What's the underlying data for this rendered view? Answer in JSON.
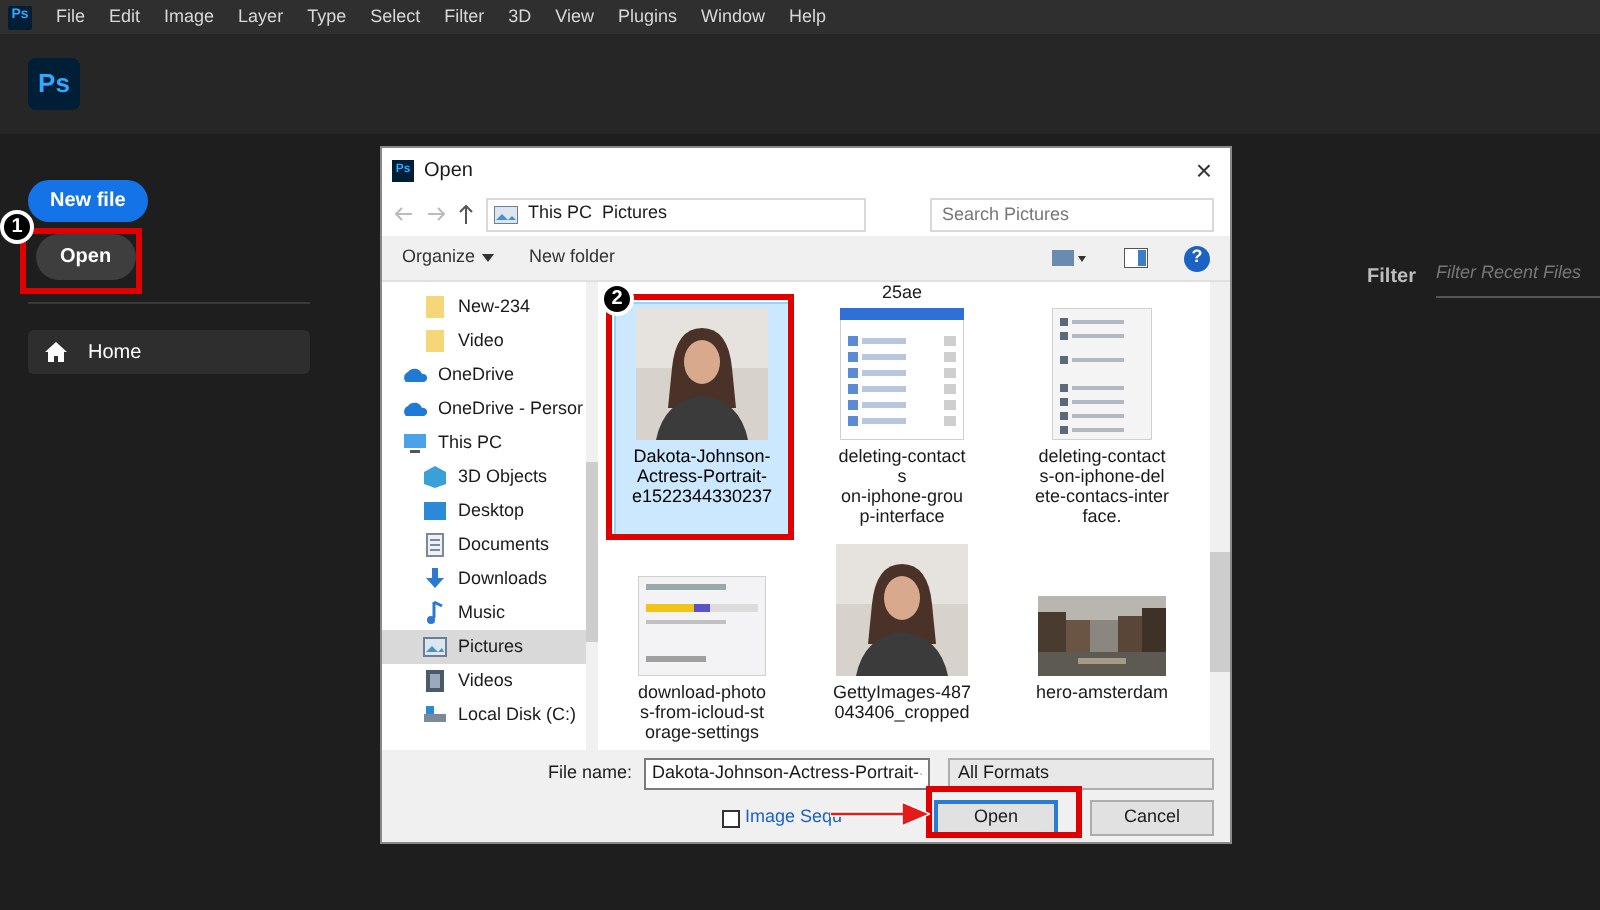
{
  "menu_bar": {
    "logo": "Ps",
    "items": [
      "File",
      "Edit",
      "Image",
      "Layer",
      "Type",
      "Select",
      "Filter",
      "3D",
      "View",
      "Plugins",
      "Window",
      "Help"
    ]
  },
  "header": {
    "logo": "Ps"
  },
  "home": {
    "buttons": [
      {
        "label": "New file",
        "kind": "primary"
      },
      {
        "label": "Open",
        "kind": "secondary"
      }
    ],
    "nav": [
      {
        "label": "Home",
        "selected": true
      }
    ],
    "filter": {
      "label": "Filter",
      "placeholder": "Filter Recent Files"
    }
  },
  "dialog": {
    "icon": "Ps",
    "title": "Open",
    "close": "×",
    "path": [
      "This PC",
      "Pictures"
    ],
    "search": {
      "placeholder": "Search Pictures"
    },
    "toolbar": [
      {
        "label": "Organize",
        "kind": "menu"
      },
      {
        "label": "New folder",
        "kind": "plain"
      }
    ],
    "help": "?",
    "nav": [
      {
        "label": "New-234",
        "kind": "folder",
        "selected": false
      },
      {
        "label": "Video",
        "kind": "folder",
        "selected": false
      },
      {
        "label": "OneDrive",
        "kind": "cloud",
        "selected": false
      },
      {
        "label": "OneDrive - Persor",
        "kind": "cloud",
        "selected": false
      },
      {
        "label": "This PC",
        "kind": "pc",
        "selected": false,
        "children": [
          {
            "label": "3D Objects",
            "kind": "cube",
            "selected": false
          },
          {
            "label": "Desktop",
            "kind": "desktop",
            "selected": false
          },
          {
            "label": "Documents",
            "kind": "document",
            "selected": false
          },
          {
            "label": "Downloads",
            "kind": "download",
            "selected": false
          },
          {
            "label": "Music",
            "kind": "music",
            "selected": false
          },
          {
            "label": "Pictures",
            "kind": "pictures",
            "selected": true
          },
          {
            "label": "Videos",
            "kind": "videos",
            "selected": false
          },
          {
            "label": "Local Disk (C:)",
            "kind": "disk",
            "selected": false
          }
        ]
      }
    ],
    "files": [
      {
        "name": "25ae",
        "kind": "cut"
      },
      {
        "name": "Dakota-Johnson-\nActress-Portrait-\ne1522344330237",
        "kind": "portrait",
        "selected": true
      },
      {
        "name": "deleting-contact\ns\non-iphone-grou\np-interface",
        "kind": "list",
        "selected": false
      },
      {
        "name": "deleting-contact\ns-on-iphone-del\nete-contacs-inter\nface.",
        "kind": "settings",
        "selected": false
      },
      {
        "name": "download-photo\ns-from-icloud-st\norage-settings",
        "kind": "storage",
        "selected": false
      },
      {
        "name": "GettyImages-487\n043406_cropped",
        "kind": "portrait",
        "selected": false
      },
      {
        "name": "hero-amsterdam",
        "kind": "city",
        "selected": false
      }
    ],
    "file_name_label": "File name:",
    "file_name": "Dakota-Johnson-Actress-Portrait-",
    "format": "All Formats",
    "image_sequence": {
      "label": "Image Sequ",
      "checked": false
    },
    "buttons": [
      {
        "label": "Open",
        "kind": "default"
      },
      {
        "label": "Cancel",
        "kind": "normal"
      }
    ]
  },
  "annotations": [
    {
      "number": "1"
    },
    {
      "number": "2"
    }
  ]
}
